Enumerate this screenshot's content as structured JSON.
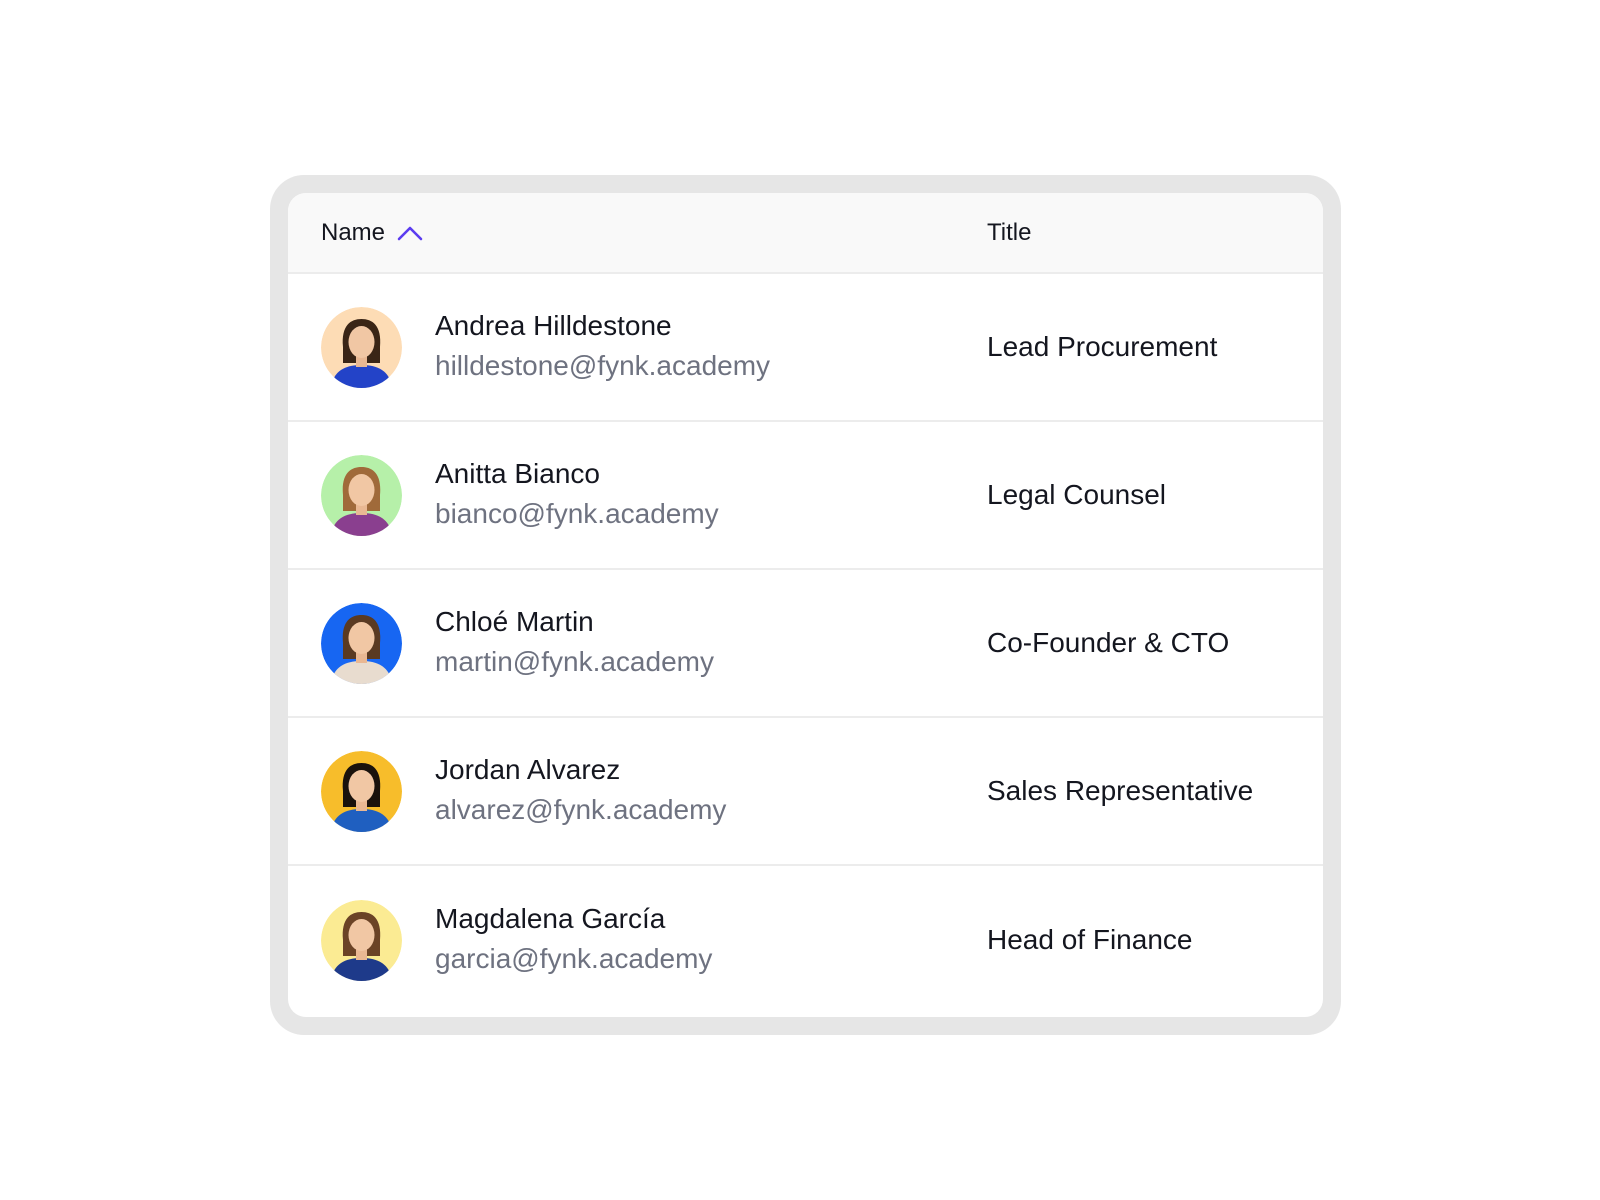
{
  "table": {
    "columns": {
      "name_label": "Name",
      "title_label": "Title",
      "sort_icon": "chevron-up-icon",
      "sort_color": "#5b3cf0"
    },
    "rows": [
      {
        "name": "Andrea Hilldestone",
        "email": "hilldestone@fynk.academy",
        "title": "Lead Procurement",
        "avatar_bg": "#fddcb5",
        "shirt": "#2343c8",
        "hair": "#3a2516"
      },
      {
        "name": "Anitta Bianco",
        "email": "bianco@fynk.academy",
        "title": "Legal Counsel",
        "avatar_bg": "#b6f0a9",
        "shirt": "#8a3f8f",
        "hair": "#a06a3a"
      },
      {
        "name": "Chloé Martin",
        "email": "martin@fynk.academy",
        "title": "Co-Founder & CTO",
        "avatar_bg": "#1766f2",
        "shirt": "#e8dccf",
        "hair": "#5a3a22"
      },
      {
        "name": "Jordan Alvarez",
        "email": "alvarez@fynk.academy",
        "title": "Sales Representative",
        "avatar_bg": "#f7bd2b",
        "shirt": "#1f5fc0",
        "hair": "#1a120c"
      },
      {
        "name": "Magdalena García",
        "email": "garcia@fynk.academy",
        "title": "Head of Finance",
        "avatar_bg": "#fbeb93",
        "shirt": "#1e3a8a",
        "hair": "#6b4326"
      }
    ]
  }
}
